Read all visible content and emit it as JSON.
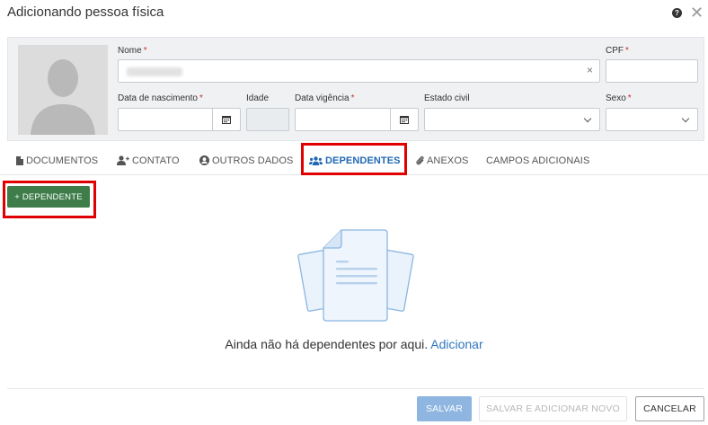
{
  "header": {
    "title": "Adicionando pessoa física",
    "help_glyph": "?",
    "close_glyph": "✕"
  },
  "form": {
    "name_label": "Nome",
    "cpf_label": "CPF",
    "birth_label": "Data de nascimento",
    "age_label": "Idade",
    "validity_label": "Data vigência",
    "civil_label": "Estado civil",
    "sex_label": "Sexo",
    "required_mark": "*",
    "clear_glyph": "×"
  },
  "tabs": [
    {
      "label": "DOCUMENTOS",
      "icon": "document-icon"
    },
    {
      "label": "CONTATO",
      "icon": "user-plus-icon"
    },
    {
      "label": "OUTROS DADOS",
      "icon": "user-circle-icon"
    },
    {
      "label": "DEPENDENTES",
      "icon": "users-icon",
      "active": true
    },
    {
      "label": "ANEXOS",
      "icon": "paperclip-icon"
    },
    {
      "label": "CAMPOS ADICIONAIS",
      "icon": ""
    }
  ],
  "add_button": {
    "label": "+ DEPENDENTE"
  },
  "empty_state": {
    "message": "Ainda não há dependentes por aqui.",
    "link": "Adicionar"
  },
  "footer": {
    "save": "SALVAR",
    "save_new": "SALVAR E ADICIONAR NOVO",
    "cancel": "CANCELAR"
  },
  "colors": {
    "accent": "#1f68b3",
    "add_button": "#3e7d4a",
    "highlight": "#e00000",
    "save_disabled": "#8eb6e1"
  }
}
